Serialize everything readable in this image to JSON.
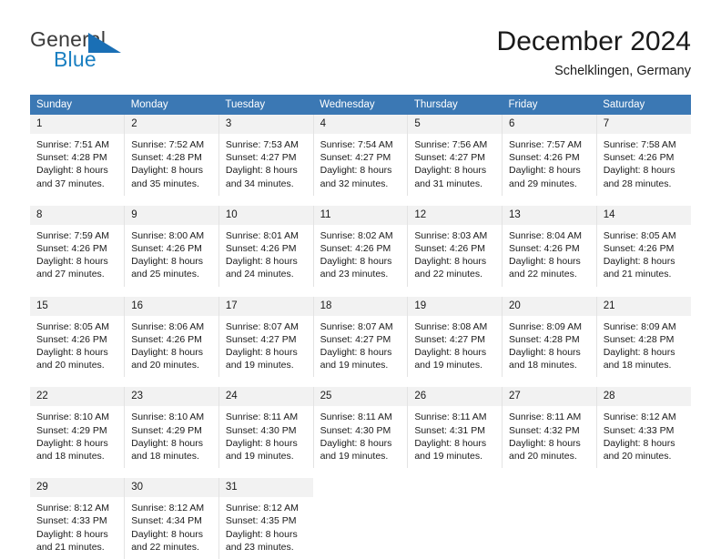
{
  "brand": {
    "name_part1": "General",
    "name_part2": "Blue",
    "mark": "triangle-logo-icon",
    "color_primary": "#1a7fc1",
    "color_dark": "#3b3b3b"
  },
  "header": {
    "title": "December 2024",
    "subtitle": "Schelklingen, Germany"
  },
  "theme": {
    "header_bg": "#3b78b4",
    "header_text": "#ffffff",
    "daynum_bg": "#f2f2f2",
    "cell_border": "#e3e3e3"
  },
  "columns": [
    "Sunday",
    "Monday",
    "Tuesday",
    "Wednesday",
    "Thursday",
    "Friday",
    "Saturday"
  ],
  "weeks": [
    {
      "days": [
        {
          "num": "1",
          "sunrise": "Sunrise: 7:51 AM",
          "sunset": "Sunset: 4:28 PM",
          "daylight1": "Daylight: 8 hours",
          "daylight2": "and 37 minutes."
        },
        {
          "num": "2",
          "sunrise": "Sunrise: 7:52 AM",
          "sunset": "Sunset: 4:28 PM",
          "daylight1": "Daylight: 8 hours",
          "daylight2": "and 35 minutes."
        },
        {
          "num": "3",
          "sunrise": "Sunrise: 7:53 AM",
          "sunset": "Sunset: 4:27 PM",
          "daylight1": "Daylight: 8 hours",
          "daylight2": "and 34 minutes."
        },
        {
          "num": "4",
          "sunrise": "Sunrise: 7:54 AM",
          "sunset": "Sunset: 4:27 PM",
          "daylight1": "Daylight: 8 hours",
          "daylight2": "and 32 minutes."
        },
        {
          "num": "5",
          "sunrise": "Sunrise: 7:56 AM",
          "sunset": "Sunset: 4:27 PM",
          "daylight1": "Daylight: 8 hours",
          "daylight2": "and 31 minutes."
        },
        {
          "num": "6",
          "sunrise": "Sunrise: 7:57 AM",
          "sunset": "Sunset: 4:26 PM",
          "daylight1": "Daylight: 8 hours",
          "daylight2": "and 29 minutes."
        },
        {
          "num": "7",
          "sunrise": "Sunrise: 7:58 AM",
          "sunset": "Sunset: 4:26 PM",
          "daylight1": "Daylight: 8 hours",
          "daylight2": "and 28 minutes."
        }
      ]
    },
    {
      "days": [
        {
          "num": "8",
          "sunrise": "Sunrise: 7:59 AM",
          "sunset": "Sunset: 4:26 PM",
          "daylight1": "Daylight: 8 hours",
          "daylight2": "and 27 minutes."
        },
        {
          "num": "9",
          "sunrise": "Sunrise: 8:00 AM",
          "sunset": "Sunset: 4:26 PM",
          "daylight1": "Daylight: 8 hours",
          "daylight2": "and 25 minutes."
        },
        {
          "num": "10",
          "sunrise": "Sunrise: 8:01 AM",
          "sunset": "Sunset: 4:26 PM",
          "daylight1": "Daylight: 8 hours",
          "daylight2": "and 24 minutes."
        },
        {
          "num": "11",
          "sunrise": "Sunrise: 8:02 AM",
          "sunset": "Sunset: 4:26 PM",
          "daylight1": "Daylight: 8 hours",
          "daylight2": "and 23 minutes."
        },
        {
          "num": "12",
          "sunrise": "Sunrise: 8:03 AM",
          "sunset": "Sunset: 4:26 PM",
          "daylight1": "Daylight: 8 hours",
          "daylight2": "and 22 minutes."
        },
        {
          "num": "13",
          "sunrise": "Sunrise: 8:04 AM",
          "sunset": "Sunset: 4:26 PM",
          "daylight1": "Daylight: 8 hours",
          "daylight2": "and 22 minutes."
        },
        {
          "num": "14",
          "sunrise": "Sunrise: 8:05 AM",
          "sunset": "Sunset: 4:26 PM",
          "daylight1": "Daylight: 8 hours",
          "daylight2": "and 21 minutes."
        }
      ]
    },
    {
      "days": [
        {
          "num": "15",
          "sunrise": "Sunrise: 8:05 AM",
          "sunset": "Sunset: 4:26 PM",
          "daylight1": "Daylight: 8 hours",
          "daylight2": "and 20 minutes."
        },
        {
          "num": "16",
          "sunrise": "Sunrise: 8:06 AM",
          "sunset": "Sunset: 4:26 PM",
          "daylight1": "Daylight: 8 hours",
          "daylight2": "and 20 minutes."
        },
        {
          "num": "17",
          "sunrise": "Sunrise: 8:07 AM",
          "sunset": "Sunset: 4:27 PM",
          "daylight1": "Daylight: 8 hours",
          "daylight2": "and 19 minutes."
        },
        {
          "num": "18",
          "sunrise": "Sunrise: 8:07 AM",
          "sunset": "Sunset: 4:27 PM",
          "daylight1": "Daylight: 8 hours",
          "daylight2": "and 19 minutes."
        },
        {
          "num": "19",
          "sunrise": "Sunrise: 8:08 AM",
          "sunset": "Sunset: 4:27 PM",
          "daylight1": "Daylight: 8 hours",
          "daylight2": "and 19 minutes."
        },
        {
          "num": "20",
          "sunrise": "Sunrise: 8:09 AM",
          "sunset": "Sunset: 4:28 PM",
          "daylight1": "Daylight: 8 hours",
          "daylight2": "and 18 minutes."
        },
        {
          "num": "21",
          "sunrise": "Sunrise: 8:09 AM",
          "sunset": "Sunset: 4:28 PM",
          "daylight1": "Daylight: 8 hours",
          "daylight2": "and 18 minutes."
        }
      ]
    },
    {
      "days": [
        {
          "num": "22",
          "sunrise": "Sunrise: 8:10 AM",
          "sunset": "Sunset: 4:29 PM",
          "daylight1": "Daylight: 8 hours",
          "daylight2": "and 18 minutes."
        },
        {
          "num": "23",
          "sunrise": "Sunrise: 8:10 AM",
          "sunset": "Sunset: 4:29 PM",
          "daylight1": "Daylight: 8 hours",
          "daylight2": "and 18 minutes."
        },
        {
          "num": "24",
          "sunrise": "Sunrise: 8:11 AM",
          "sunset": "Sunset: 4:30 PM",
          "daylight1": "Daylight: 8 hours",
          "daylight2": "and 19 minutes."
        },
        {
          "num": "25",
          "sunrise": "Sunrise: 8:11 AM",
          "sunset": "Sunset: 4:30 PM",
          "daylight1": "Daylight: 8 hours",
          "daylight2": "and 19 minutes."
        },
        {
          "num": "26",
          "sunrise": "Sunrise: 8:11 AM",
          "sunset": "Sunset: 4:31 PM",
          "daylight1": "Daylight: 8 hours",
          "daylight2": "and 19 minutes."
        },
        {
          "num": "27",
          "sunrise": "Sunrise: 8:11 AM",
          "sunset": "Sunset: 4:32 PM",
          "daylight1": "Daylight: 8 hours",
          "daylight2": "and 20 minutes."
        },
        {
          "num": "28",
          "sunrise": "Sunrise: 8:12 AM",
          "sunset": "Sunset: 4:33 PM",
          "daylight1": "Daylight: 8 hours",
          "daylight2": "and 20 minutes."
        }
      ]
    },
    {
      "days": [
        {
          "num": "29",
          "sunrise": "Sunrise: 8:12 AM",
          "sunset": "Sunset: 4:33 PM",
          "daylight1": "Daylight: 8 hours",
          "daylight2": "and 21 minutes."
        },
        {
          "num": "30",
          "sunrise": "Sunrise: 8:12 AM",
          "sunset": "Sunset: 4:34 PM",
          "daylight1": "Daylight: 8 hours",
          "daylight2": "and 22 minutes."
        },
        {
          "num": "31",
          "sunrise": "Sunrise: 8:12 AM",
          "sunset": "Sunset: 4:35 PM",
          "daylight1": "Daylight: 8 hours",
          "daylight2": "and 23 minutes."
        },
        {
          "num": "",
          "sunrise": "",
          "sunset": "",
          "daylight1": "",
          "daylight2": ""
        },
        {
          "num": "",
          "sunrise": "",
          "sunset": "",
          "daylight1": "",
          "daylight2": ""
        },
        {
          "num": "",
          "sunrise": "",
          "sunset": "",
          "daylight1": "",
          "daylight2": ""
        },
        {
          "num": "",
          "sunrise": "",
          "sunset": "",
          "daylight1": "",
          "daylight2": ""
        }
      ]
    }
  ]
}
